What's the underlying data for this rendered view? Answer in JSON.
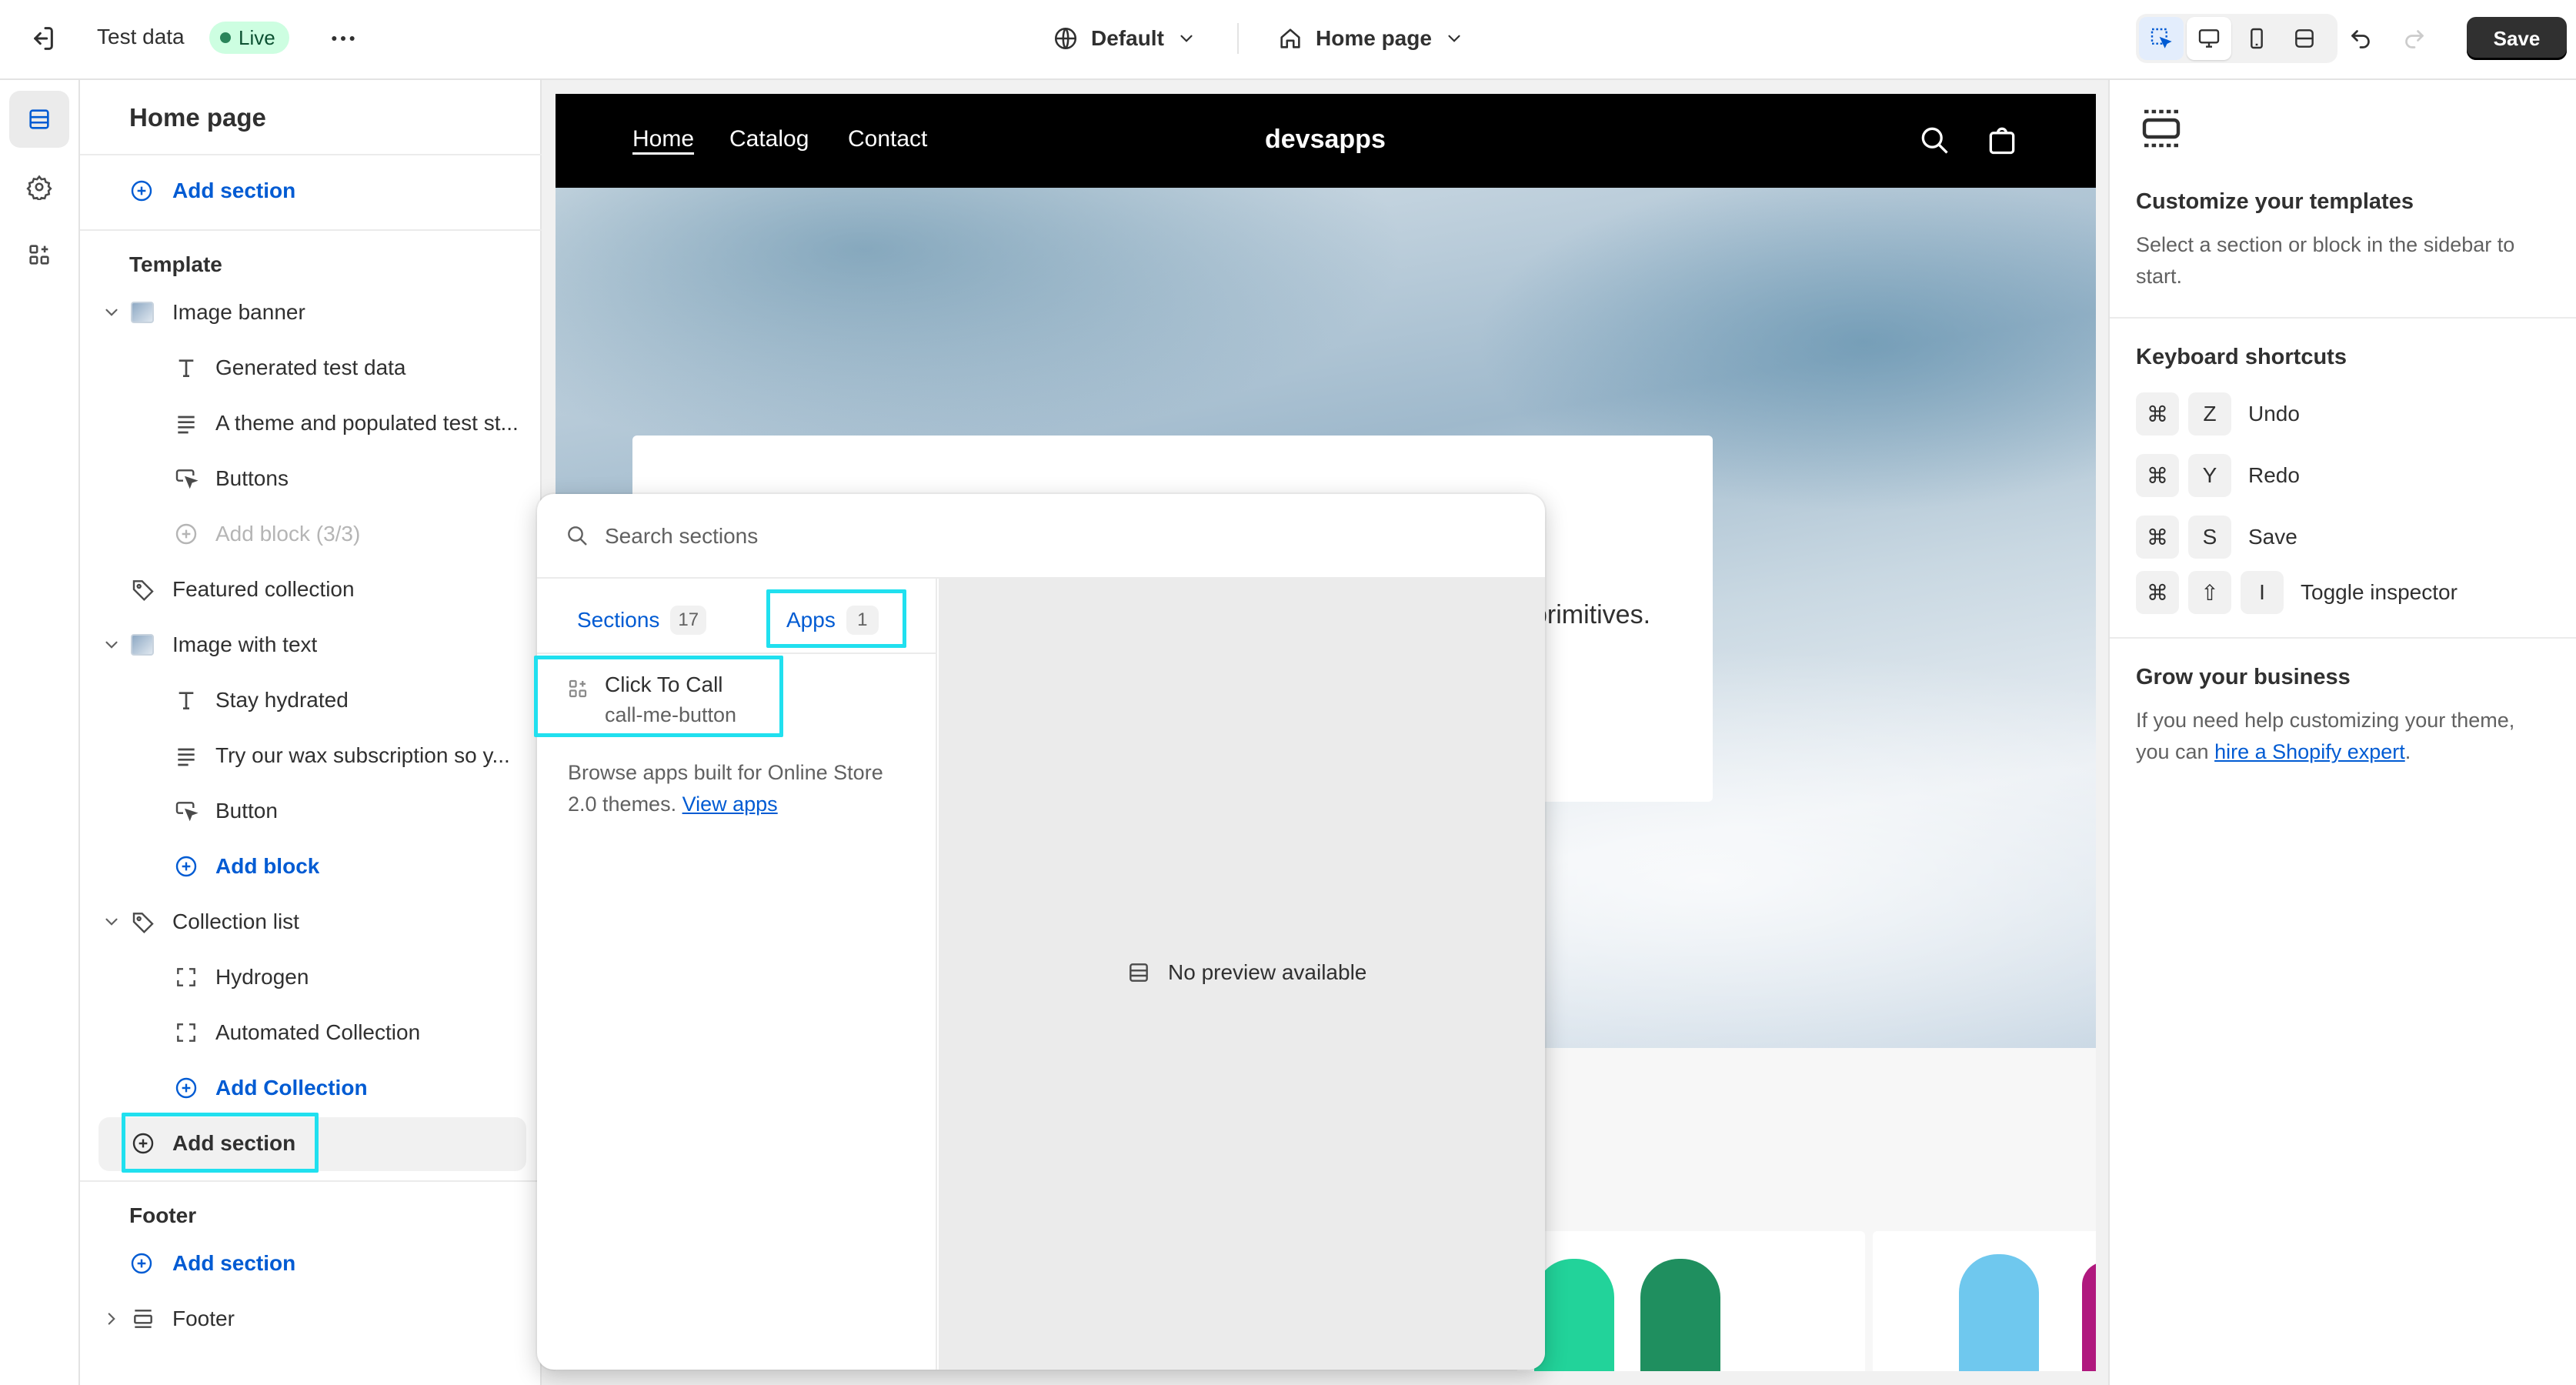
{
  "topbar": {
    "store_name": "Test data",
    "status_badge": "Live",
    "theme_select": "Default",
    "page_select": "Home page",
    "save_label": "Save"
  },
  "sidebar": {
    "title": "Home page",
    "header_add_section": "Add section",
    "template_heading": "Template",
    "items": {
      "image_banner": "Image banner",
      "generated_test_data": "Generated test data",
      "theme_text": "A theme and populated test st...",
      "buttons": "Buttons",
      "add_block_limit": "Add block (3/3)",
      "featured_collection": "Featured collection",
      "image_with_text": "Image with text",
      "stay_hydrated": "Stay hydrated",
      "wax_text": "Try our wax subscription so y...",
      "button": "Button",
      "add_block": "Add block",
      "collection_list": "Collection list",
      "hydrogen": "Hydrogen",
      "automated_collection": "Automated Collection",
      "add_collection": "Add Collection",
      "add_section": "Add section"
    },
    "footer_heading": "Footer",
    "footer_add_section": "Add section",
    "footer_item": "Footer"
  },
  "preview": {
    "nav": [
      "Home",
      "Catalog",
      "Contact"
    ],
    "logo": "devsapps",
    "banner_text_fragment": "primitives."
  },
  "popover": {
    "search_placeholder": "Search sections",
    "tabs": [
      {
        "label": "Sections",
        "count": "17"
      },
      {
        "label": "Apps",
        "count": "1"
      }
    ],
    "app": {
      "title": "Click To Call",
      "subtitle": "call-me-button"
    },
    "browse_text": "Browse apps built for Online Store 2.0 themes.",
    "browse_link": "View apps",
    "no_preview": "No preview available"
  },
  "right_panel": {
    "customize_title": "Customize your templates",
    "customize_text": "Select a section or block in the sidebar to start.",
    "shortcuts_title": "Keyboard shortcuts",
    "shortcuts": [
      {
        "mod": "⌘",
        "key": "Z",
        "label": "Undo"
      },
      {
        "mod": "⌘",
        "key": "Y",
        "label": "Redo"
      },
      {
        "mod": "⌘",
        "key": "S",
        "label": "Save"
      },
      {
        "mod": "⌘",
        "shift": "⇧",
        "key": "I",
        "label": "Toggle inspector"
      }
    ],
    "grow_title": "Grow your business",
    "grow_text_before": "If you need help customizing your theme, you can",
    "grow_link": "hire a Shopify expert",
    "grow_text_after": "."
  },
  "colors": {
    "accent": "#005bd3",
    "highlight": "#20e0ef",
    "live_badge_bg": "#cdfee1",
    "save_bg": "#303030"
  }
}
